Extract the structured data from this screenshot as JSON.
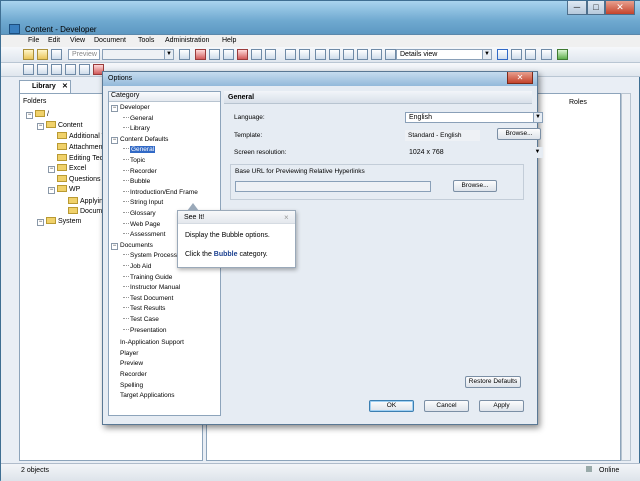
{
  "window": {
    "title": "Content - Developer",
    "min": "─",
    "max": "□",
    "close": "✕"
  },
  "menu": [
    "File",
    "Edit",
    "View",
    "Document",
    "Tools",
    "Administration",
    "Help"
  ],
  "toolbar": {
    "preview_label": "Preview",
    "view_combo": "Details view"
  },
  "library": {
    "tab": "Library",
    "tab_close": "✕",
    "folders_header": "Folders",
    "roles_header": "Roles",
    "tree": [
      {
        "label": "/",
        "level": 0
      },
      {
        "label": "Content",
        "level": 1
      },
      {
        "label": "Additional Top",
        "level": 2
      },
      {
        "label": "Attachments",
        "level": 2
      },
      {
        "label": "Editing Techni",
        "level": 2
      },
      {
        "label": "Excel",
        "level": 2
      },
      {
        "label": "Questions and",
        "level": 2
      },
      {
        "label": "WP",
        "level": 2
      },
      {
        "label": "Applying F",
        "level": 3
      },
      {
        "label": "Documen",
        "level": 3
      },
      {
        "label": "System",
        "level": 1
      }
    ]
  },
  "status": {
    "left": "2 objects",
    "right": "Online"
  },
  "dialog": {
    "title": "Options",
    "close": "✕",
    "category_header": "Category",
    "categories": [
      {
        "label": "Developer",
        "level": 0,
        "exp": "−"
      },
      {
        "label": "General",
        "level": 1
      },
      {
        "label": "Library",
        "level": 1
      },
      {
        "label": "Content Defaults",
        "level": 0,
        "exp": "−"
      },
      {
        "label": "General",
        "level": 1,
        "selected": true
      },
      {
        "label": "Topic",
        "level": 1
      },
      {
        "label": "Recorder",
        "level": 1
      },
      {
        "label": "Bubble",
        "level": 1
      },
      {
        "label": "Introduction/End Frame",
        "level": 1
      },
      {
        "label": "String Input",
        "level": 1
      },
      {
        "label": "Glossary",
        "level": 1
      },
      {
        "label": "Web Page",
        "level": 1
      },
      {
        "label": "Assessment",
        "level": 1
      },
      {
        "label": "Documents",
        "level": 0,
        "exp": "−"
      },
      {
        "label": "System Process",
        "level": 1
      },
      {
        "label": "Job Aid",
        "level": 1
      },
      {
        "label": "Training Guide",
        "level": 1
      },
      {
        "label": "Instructor Manual",
        "level": 1
      },
      {
        "label": "Test Document",
        "level": 1
      },
      {
        "label": "Test Results",
        "level": 1
      },
      {
        "label": "Test Case",
        "level": 1
      },
      {
        "label": "Presentation",
        "level": 1
      },
      {
        "label": "In-Application Support",
        "level": 0
      },
      {
        "label": "Player",
        "level": 0
      },
      {
        "label": "Preview",
        "level": 0
      },
      {
        "label": "Recorder",
        "level": 0
      },
      {
        "label": "Spelling",
        "level": 0
      },
      {
        "label": "Target Applications",
        "level": 0
      }
    ],
    "general": {
      "header": "General",
      "language_label": "Language:",
      "language_value": "English",
      "template_label": "Template:",
      "template_value": "Standard - English",
      "browse1": "Browse...",
      "resolution_label": "Screen resolution:",
      "resolution_value": "1024 x 768",
      "baseurl_label": "Base URL for Previewing Relative Hyperlinks",
      "baseurl_value": "",
      "browse2": "Browse...",
      "restore": "Restore Defaults"
    },
    "buttons": {
      "ok": "OK",
      "cancel": "Cancel",
      "apply": "Apply"
    }
  },
  "tooltip": {
    "title": "See It!",
    "close": "×",
    "line1": "Display the Bubble options.",
    "line2_pre": "Click the ",
    "line2_bold": "Bubble",
    "line2_post": " category."
  },
  "colors": {
    "accent": "#3169c6",
    "title_bar": "#6fa9d0",
    "dialog_bg": "#e6ecf3"
  }
}
